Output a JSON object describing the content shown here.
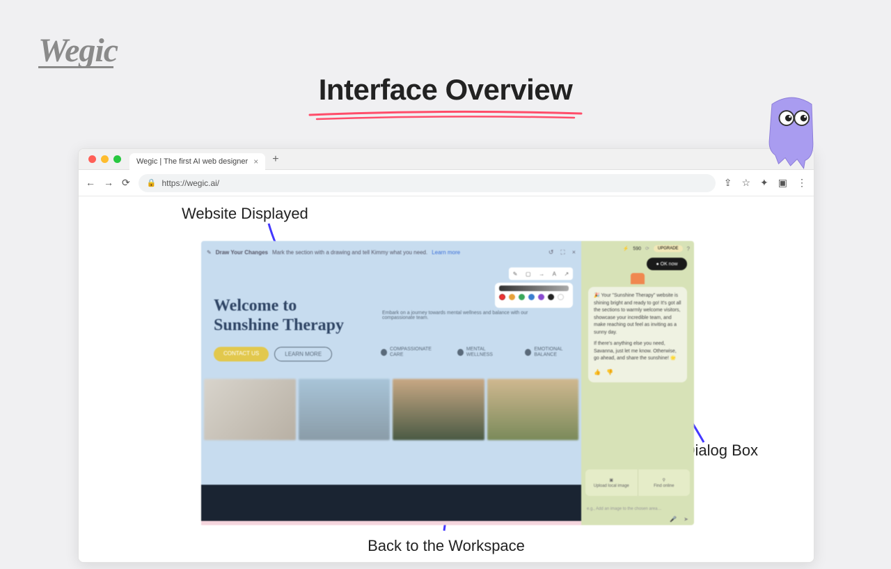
{
  "logo_text": "Wegic",
  "page_title": "Interface Overview",
  "browser": {
    "tab_title": "Wegic | The first AI web designer",
    "url": "https://wegic.ai/"
  },
  "annotations": {
    "website_displayed": "Website Displayed",
    "dialog_box": "Dialog Box",
    "back_workspace": "Back to the Workspace"
  },
  "canvas": {
    "toolbar_hint_label": "Draw Your Changes",
    "toolbar_hint_text": "Mark the section with a drawing and tell Kimmy what you need.",
    "learn_more": "Learn more",
    "hero_line1": "Welcome to",
    "hero_line2": "Sunshine Therapy",
    "hero_sub": "Embark on a journey towards mental wellness and balance with our compassionate team.",
    "btn_contact": "CONTACT US",
    "btn_learn": "LEARN MORE",
    "feat1": "COMPASSIONATE CARE",
    "feat2": "MENTAL WELLNESS",
    "feat3": "EMOTIONAL BALANCE"
  },
  "sidebar": {
    "credits": "590",
    "upgrade": "UPGRADE",
    "ok_now": "● OK now",
    "msg_p1": "🎉 Your \"Sunshine Therapy\" website is shining bright and ready to go! It's got all the sections to warmly welcome visitors, showcase your incredible team, and make reaching out feel as inviting as a sunny day.",
    "msg_p2": "If there's anything else you need, Savanna, just let me know. Otherwise, go ahead, and share the sunshine! 🌟",
    "upload_local": "Upload local image",
    "find_online": "Find online",
    "input_placeholder": "e.g., Add an image to the chosen area…"
  }
}
